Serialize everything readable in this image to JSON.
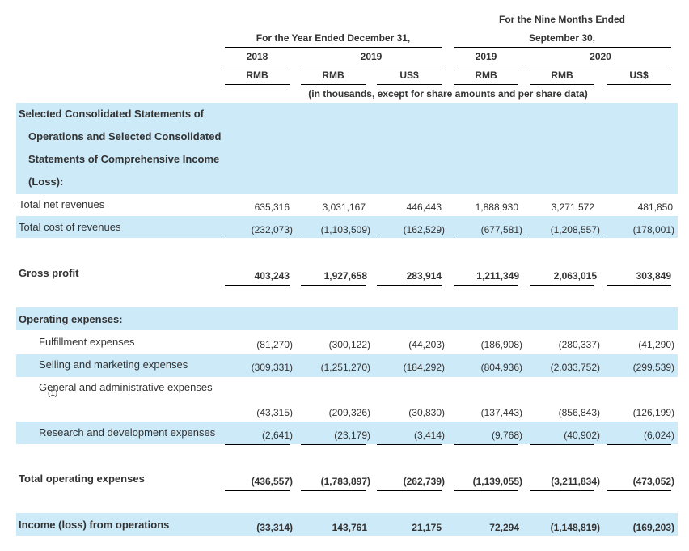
{
  "header": {
    "nine_months_line1": "For the Nine Months Ended",
    "nine_months_line2": "September 30,",
    "year_ended": "For the Year Ended December 31,",
    "years": [
      "2018",
      "2019",
      "2019",
      "2020"
    ],
    "currencies": [
      "RMB",
      "RMB",
      "US$",
      "RMB",
      "RMB",
      "US$"
    ],
    "note": "(in thousands, except for share amounts and per share data)"
  },
  "section_title": {
    "line1": "Selected Consolidated Statements of",
    "line2": "Operations and Selected Consolidated",
    "line3": "Statements of Comprehensive Income",
    "line4": "(Loss):"
  },
  "rows": [
    {
      "label": "Total net revenues",
      "values": [
        "635,316",
        "3,031,167",
        "446,443",
        "1,888,930",
        "3,271,572",
        "481,850"
      ]
    },
    {
      "label": "Total cost of revenues",
      "values": [
        "(232,073)",
        "(1,103,509)",
        "(162,529)",
        "(677,581)",
        "(1,208,557)",
        "(178,001)"
      ]
    },
    {
      "label": "Gross profit",
      "values": [
        "403,243",
        "1,927,658",
        "283,914",
        "1,211,349",
        "2,063,015",
        "303,849"
      ]
    },
    {
      "label": "Operating expenses:",
      "values": []
    },
    {
      "label": "Fulfillment expenses",
      "values": [
        "(81,270)",
        "(300,122)",
        "(44,203)",
        "(186,908)",
        "(280,337)",
        "(41,290)"
      ]
    },
    {
      "label": "Selling and marketing expenses",
      "values": [
        "(309,331)",
        "(1,251,270)",
        "(184,292)",
        "(804,936)",
        "(2,033,752)",
        "(299,539)"
      ]
    },
    {
      "label": "General and administrative expenses",
      "footnote": "(1)",
      "values": [
        "(43,315)",
        "(209,326)",
        "(30,830)",
        "(137,443)",
        "(856,843)",
        "(126,199)"
      ]
    },
    {
      "label": "Research and development expenses",
      "values": [
        "(2,641)",
        "(23,179)",
        "(3,414)",
        "(9,768)",
        "(40,902)",
        "(6,024)"
      ]
    },
    {
      "label": "Total operating expenses",
      "values": [
        "(436,557)",
        "(1,783,897)",
        "(262,739)",
        "(1,139,055)",
        "(3,211,834)",
        "(473,052)"
      ]
    },
    {
      "label": "Income (loss) from operations",
      "values": [
        "(33,314)",
        "143,761",
        "21,175",
        "72,294",
        "(1,148,819)",
        "(169,203)"
      ]
    }
  ],
  "colors": {
    "band": "#cdeaf9",
    "text": "#333333",
    "rule": "#000000"
  }
}
